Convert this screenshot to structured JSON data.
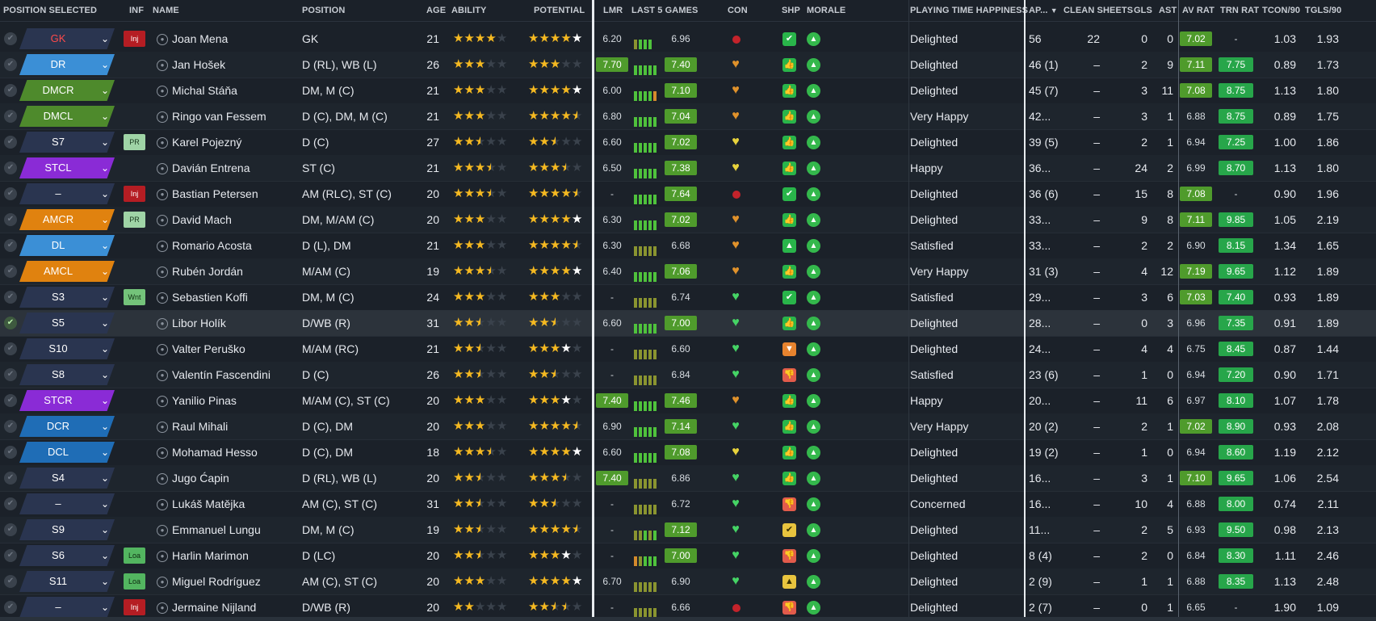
{
  "headers": {
    "position_selected": "POSITION SELECTED",
    "inf": "INF",
    "name": "NAME",
    "position": "POSITION",
    "age": "AGE",
    "ability": "ABILITY",
    "potential": "POTENTIAL",
    "lmr": "LMR",
    "last5": "LAST 5 GAMES",
    "con": "CON",
    "shp": "SHP",
    "morale": "MORALE",
    "pth": "PLAYING TIME HAPPINESS",
    "apps": "AP...",
    "sort_arrow": "▼",
    "clean_sheets": "CLEAN SHEETS",
    "gls": "GLS",
    "ast": "AST",
    "av_rat": "AV RAT",
    "trn_rat": "TRN RAT",
    "tcon90": "TCON/90",
    "tgls90": "TGLS/90"
  },
  "colors": {
    "blue": "#3b8fd6",
    "darkblue": "#1f6db6",
    "green": "#4e8a2c",
    "purple": "#8a2bd6",
    "orange": "#e0820f",
    "navy": "#2a3550",
    "red": "#b51d23"
  },
  "players": [
    {
      "pos": "GK",
      "posColor": "navy",
      "posText": "red",
      "inf": "Inj",
      "name": "Joan Mena",
      "position": "GK",
      "age": "21",
      "ability": [
        1,
        1,
        1,
        1,
        0
      ],
      "potential": [
        1,
        1,
        1,
        1,
        3
      ],
      "lmr": "6.20",
      "lmrHi": false,
      "bars": "yggg",
      "l5": "6.96",
      "l5Hi": false,
      "con": "red",
      "shp": "green",
      "shpIcon": "✔",
      "mor": "▲",
      "pth": "Delighted",
      "apps": "56",
      "cs": "22",
      "gls": "0",
      "ast": "0",
      "avr": "7.02",
      "avrHi": true,
      "trn": "-",
      "trnHi": false,
      "tcon": "1.03",
      "tgls": "1.93"
    },
    {
      "pos": "DR",
      "posColor": "blue",
      "inf": "",
      "name": "Jan Hošek",
      "position": "D (RL), WB (L)",
      "age": "26",
      "ability": [
        1,
        1,
        1,
        0,
        0
      ],
      "potential": [
        1,
        1,
        1,
        0,
        0
      ],
      "lmr": "7.70",
      "lmrHi": true,
      "bars": "ggggg",
      "l5": "7.40",
      "l5Hi": true,
      "con": "orange",
      "shp": "green",
      "shpIcon": "👍",
      "mor": "▲",
      "pth": "Delighted",
      "apps": "46 (1)",
      "cs": "–",
      "gls": "2",
      "ast": "9",
      "avr": "7.11",
      "avrHi": true,
      "trn": "7.75",
      "trnHi": true,
      "tcon": "0.89",
      "tgls": "1.73"
    },
    {
      "pos": "DMCR",
      "posColor": "green",
      "inf": "",
      "name": "Michal Stáňa",
      "position": "DM, M (C)",
      "age": "21",
      "ability": [
        1,
        1,
        1,
        0,
        0
      ],
      "potential": [
        1,
        1,
        1,
        1,
        3
      ],
      "lmr": "6.00",
      "lmrHi": false,
      "bars": "ggggo",
      "l5": "7.10",
      "l5Hi": true,
      "con": "orange",
      "shp": "green",
      "shpIcon": "👍",
      "mor": "▲",
      "pth": "Delighted",
      "apps": "45 (7)",
      "cs": "–",
      "gls": "3",
      "ast": "11",
      "avr": "7.08",
      "avrHi": true,
      "trn": "8.75",
      "trnHi": true,
      "tcon": "1.13",
      "tgls": "1.80"
    },
    {
      "pos": "DMCL",
      "posColor": "green",
      "inf": "",
      "name": "Ringo van Fessem",
      "position": "D (C), DM, M (C)",
      "age": "21",
      "ability": [
        1,
        1,
        1,
        0,
        0
      ],
      "potential": [
        1,
        1,
        1,
        1,
        2
      ],
      "lmr": "6.80",
      "lmrHi": false,
      "bars": "ggggg",
      "l5": "7.04",
      "l5Hi": true,
      "con": "orange",
      "shp": "green",
      "shpIcon": "👍",
      "mor": "▲",
      "pth": "Very Happy",
      "apps": "42...",
      "cs": "–",
      "gls": "3",
      "ast": "1",
      "avr": "6.88",
      "avrHi": false,
      "trn": "8.75",
      "trnHi": true,
      "tcon": "0.89",
      "tgls": "1.75"
    },
    {
      "pos": "S7",
      "posColor": "navy",
      "inf": "PR",
      "name": "Karel Pojezný",
      "position": "D (C)",
      "age": "27",
      "ability": [
        1,
        1,
        2,
        0,
        0
      ],
      "potential": [
        1,
        1,
        2,
        0,
        0
      ],
      "lmr": "6.60",
      "lmrHi": false,
      "bars": "ggggg",
      "l5": "7.02",
      "l5Hi": true,
      "con": "yellow",
      "shp": "green",
      "shpIcon": "👍",
      "mor": "▲",
      "pth": "Delighted",
      "apps": "39 (5)",
      "cs": "–",
      "gls": "2",
      "ast": "1",
      "avr": "6.94",
      "avrHi": false,
      "trn": "7.25",
      "trnHi": true,
      "tcon": "1.00",
      "tgls": "1.86"
    },
    {
      "pos": "STCL",
      "posColor": "purple",
      "inf": "",
      "name": "Davián Entrena",
      "position": "ST (C)",
      "age": "21",
      "ability": [
        1,
        1,
        1,
        2,
        0
      ],
      "potential": [
        1,
        1,
        1,
        2,
        0
      ],
      "lmr": "6.50",
      "lmrHi": false,
      "bars": "ggggg",
      "l5": "7.38",
      "l5Hi": true,
      "con": "yellow",
      "shp": "green",
      "shpIcon": "👍",
      "mor": "▲",
      "pth": "Happy",
      "apps": "36...",
      "cs": "–",
      "gls": "24",
      "ast": "2",
      "avr": "6.99",
      "avrHi": false,
      "trn": "8.70",
      "trnHi": true,
      "tcon": "1.13",
      "tgls": "1.80"
    },
    {
      "pos": "–",
      "posColor": "navy",
      "inf": "Inj",
      "name": "Bastian Petersen",
      "position": "AM (RLC), ST (C)",
      "age": "20",
      "ability": [
        1,
        1,
        1,
        2,
        0
      ],
      "potential": [
        1,
        1,
        1,
        1,
        2
      ],
      "lmr": "-",
      "lmrHi": false,
      "bars": "ggggg",
      "l5": "7.64",
      "l5Hi": true,
      "con": "red",
      "shp": "green",
      "shpIcon": "✔",
      "mor": "▲",
      "pth": "Delighted",
      "apps": "36 (6)",
      "cs": "–",
      "gls": "15",
      "ast": "8",
      "avr": "7.08",
      "avrHi": true,
      "trn": "-",
      "trnHi": false,
      "tcon": "0.90",
      "tgls": "1.96"
    },
    {
      "pos": "AMCR",
      "posColor": "orange",
      "inf": "PR",
      "name": "David Mach",
      "position": "DM, M/AM (C)",
      "age": "20",
      "ability": [
        1,
        1,
        1,
        0,
        0
      ],
      "potential": [
        1,
        1,
        1,
        1,
        3
      ],
      "lmr": "6.30",
      "lmrHi": false,
      "bars": "ggggg",
      "l5": "7.02",
      "l5Hi": true,
      "con": "orange",
      "shp": "green",
      "shpIcon": "👍",
      "mor": "▲",
      "pth": "Delighted",
      "apps": "33...",
      "cs": "–",
      "gls": "9",
      "ast": "8",
      "avr": "7.11",
      "avrHi": true,
      "trn": "9.85",
      "trnHi": true,
      "tcon": "1.05",
      "tgls": "2.19"
    },
    {
      "pos": "DL",
      "posColor": "blue",
      "inf": "",
      "name": "Romario Acosta",
      "position": "D (L), DM",
      "age": "21",
      "ability": [
        1,
        1,
        1,
        0,
        0
      ],
      "potential": [
        1,
        1,
        1,
        1,
        2
      ],
      "lmr": "6.30",
      "lmrHi": false,
      "bars": "yyyyy",
      "l5": "6.68",
      "l5Hi": false,
      "con": "orange",
      "shp": "green",
      "shpIcon": "▲",
      "mor": "▲",
      "pth": "Satisfied",
      "apps": "33...",
      "cs": "–",
      "gls": "2",
      "ast": "2",
      "avr": "6.90",
      "avrHi": false,
      "trn": "8.15",
      "trnHi": true,
      "tcon": "1.34",
      "tgls": "1.65"
    },
    {
      "pos": "AMCL",
      "posColor": "orange",
      "inf": "",
      "name": "Rubén Jordán",
      "position": "M/AM (C)",
      "age": "19",
      "ability": [
        1,
        1,
        1,
        2,
        0
      ],
      "potential": [
        1,
        1,
        1,
        1,
        3
      ],
      "lmr": "6.40",
      "lmrHi": false,
      "bars": "ggggg",
      "l5": "7.06",
      "l5Hi": true,
      "con": "orange",
      "shp": "green",
      "shpIcon": "👍",
      "mor": "▲",
      "pth": "Very Happy",
      "apps": "31 (3)",
      "cs": "–",
      "gls": "4",
      "ast": "12",
      "avr": "7.19",
      "avrHi": true,
      "trn": "9.65",
      "trnHi": true,
      "tcon": "1.12",
      "tgls": "1.89"
    },
    {
      "pos": "S3",
      "posColor": "navy",
      "inf": "Wnt",
      "name": "Sebastien Koffi",
      "position": "DM, M (C)",
      "age": "24",
      "ability": [
        1,
        1,
        1,
        0,
        0
      ],
      "potential": [
        1,
        1,
        1,
        0,
        0
      ],
      "lmr": "-",
      "lmrHi": false,
      "bars": "yyyyy",
      "l5": "6.74",
      "l5Hi": false,
      "con": "green",
      "shp": "green",
      "shpIcon": "✔",
      "mor": "▲",
      "pth": "Satisfied",
      "apps": "29...",
      "cs": "–",
      "gls": "3",
      "ast": "6",
      "avr": "7.03",
      "avrHi": true,
      "trn": "7.40",
      "trnHi": true,
      "tcon": "0.93",
      "tgls": "1.89"
    },
    {
      "pos": "S5",
      "posColor": "navy",
      "inf": "",
      "name": "Libor Holík",
      "position": "D/WB (R)",
      "age": "31",
      "ability": [
        1,
        1,
        2,
        0,
        0
      ],
      "potential": [
        1,
        1,
        2,
        0,
        0
      ],
      "lmr": "6.60",
      "lmrHi": false,
      "bars": "ggggg",
      "l5": "7.00",
      "l5Hi": true,
      "con": "green",
      "shp": "green",
      "shpIcon": "👍",
      "mor": "▲",
      "pth": "Delighted",
      "apps": "28...",
      "cs": "–",
      "gls": "0",
      "ast": "3",
      "avr": "6.96",
      "avrHi": false,
      "trn": "7.35",
      "trnHi": true,
      "tcon": "0.91",
      "tgls": "1.89",
      "selected": true
    },
    {
      "pos": "S10",
      "posColor": "navy",
      "inf": "",
      "name": "Valter Peruško",
      "position": "M/AM (RC)",
      "age": "21",
      "ability": [
        1,
        1,
        2,
        0,
        0
      ],
      "potential": [
        1,
        1,
        1,
        3,
        0
      ],
      "lmr": "-",
      "lmrHi": false,
      "bars": "yyyyy",
      "l5": "6.60",
      "l5Hi": false,
      "con": "green",
      "shp": "orange",
      "shpIcon": "▼",
      "mor": "▲",
      "pth": "Delighted",
      "apps": "24...",
      "cs": "–",
      "gls": "4",
      "ast": "4",
      "avr": "6.75",
      "avrHi": false,
      "trn": "8.45",
      "trnHi": true,
      "tcon": "0.87",
      "tgls": "1.44"
    },
    {
      "pos": "S8",
      "posColor": "navy",
      "inf": "",
      "name": "Valentín Fascendini",
      "position": "D (C)",
      "age": "26",
      "ability": [
        1,
        1,
        2,
        0,
        0
      ],
      "potential": [
        1,
        1,
        2,
        0,
        0
      ],
      "lmr": "-",
      "lmrHi": false,
      "bars": "yyyyy",
      "l5": "6.84",
      "l5Hi": false,
      "con": "green",
      "shp": "red",
      "shpIcon": "👎",
      "mor": "▲",
      "pth": "Satisfied",
      "apps": "23 (6)",
      "cs": "–",
      "gls": "1",
      "ast": "0",
      "avr": "6.94",
      "avrHi": false,
      "trn": "7.20",
      "trnHi": true,
      "tcon": "0.90",
      "tgls": "1.71"
    },
    {
      "pos": "STCR",
      "posColor": "purple",
      "inf": "",
      "name": "Yanilio Pinas",
      "position": "M/AM (C), ST (C)",
      "age": "20",
      "ability": [
        1,
        1,
        1,
        0,
        0
      ],
      "potential": [
        1,
        1,
        1,
        3,
        0
      ],
      "lmr": "7.40",
      "lmrHi": true,
      "bars": "ggggg",
      "l5": "7.46",
      "l5Hi": true,
      "con": "orange",
      "shp": "green",
      "shpIcon": "👍",
      "mor": "▲",
      "pth": "Happy",
      "apps": "20...",
      "cs": "–",
      "gls": "11",
      "ast": "6",
      "avr": "6.97",
      "avrHi": false,
      "trn": "8.10",
      "trnHi": true,
      "tcon": "1.07",
      "tgls": "1.78"
    },
    {
      "pos": "DCR",
      "posColor": "darkblue",
      "inf": "",
      "name": "Raul Mihali",
      "position": "D (C), DM",
      "age": "20",
      "ability": [
        1,
        1,
        1,
        0,
        0
      ],
      "potential": [
        1,
        1,
        1,
        1,
        2
      ],
      "lmr": "6.90",
      "lmrHi": false,
      "bars": "ggggg",
      "l5": "7.14",
      "l5Hi": true,
      "con": "green",
      "shp": "green",
      "shpIcon": "👍",
      "mor": "▲",
      "pth": "Very Happy",
      "apps": "20 (2)",
      "cs": "–",
      "gls": "2",
      "ast": "1",
      "avr": "7.02",
      "avrHi": true,
      "trn": "8.90",
      "trnHi": true,
      "tcon": "0.93",
      "tgls": "2.08"
    },
    {
      "pos": "DCL",
      "posColor": "darkblue",
      "inf": "",
      "name": "Mohamad Hesso",
      "position": "D (C), DM",
      "age": "18",
      "ability": [
        1,
        1,
        1,
        2,
        0
      ],
      "potential": [
        1,
        1,
        1,
        1,
        3
      ],
      "lmr": "6.60",
      "lmrHi": false,
      "bars": "ggggg",
      "l5": "7.08",
      "l5Hi": true,
      "con": "yellow",
      "shp": "green",
      "shpIcon": "👍",
      "mor": "▲",
      "pth": "Delighted",
      "apps": "19 (2)",
      "cs": "–",
      "gls": "1",
      "ast": "0",
      "avr": "6.94",
      "avrHi": false,
      "trn": "8.60",
      "trnHi": true,
      "tcon": "1.19",
      "tgls": "2.12"
    },
    {
      "pos": "S4",
      "posColor": "navy",
      "inf": "",
      "name": "Jugo Ćapin",
      "position": "D (RL), WB (L)",
      "age": "20",
      "ability": [
        1,
        1,
        2,
        0,
        0
      ],
      "potential": [
        1,
        1,
        1,
        2,
        0
      ],
      "lmr": "7.40",
      "lmrHi": true,
      "bars": "yyyyy",
      "l5": "6.86",
      "l5Hi": false,
      "con": "green",
      "shp": "green",
      "shpIcon": "👍",
      "mor": "▲",
      "pth": "Delighted",
      "apps": "16...",
      "cs": "–",
      "gls": "3",
      "ast": "1",
      "avr": "7.10",
      "avrHi": true,
      "trn": "9.65",
      "trnHi": true,
      "tcon": "1.06",
      "tgls": "2.54"
    },
    {
      "pos": "–",
      "posColor": "navy",
      "inf": "",
      "name": "Lukáš Matějka",
      "position": "AM (C), ST (C)",
      "age": "31",
      "ability": [
        1,
        1,
        2,
        0,
        0
      ],
      "potential": [
        1,
        1,
        2,
        0,
        0
      ],
      "lmr": "-",
      "lmrHi": false,
      "bars": "yyyyy",
      "l5": "6.72",
      "l5Hi": false,
      "con": "green",
      "shp": "red",
      "shpIcon": "👎",
      "mor": "▲",
      "pth": "Concerned",
      "apps": "16...",
      "cs": "–",
      "gls": "10",
      "ast": "4",
      "avr": "6.88",
      "avrHi": false,
      "trn": "8.00",
      "trnHi": true,
      "tcon": "0.74",
      "tgls": "2.11"
    },
    {
      "pos": "S9",
      "posColor": "navy",
      "inf": "",
      "name": "Emmanuel Lungu",
      "position": "DM, M (C)",
      "age": "19",
      "ability": [
        1,
        1,
        2,
        0,
        0
      ],
      "potential": [
        1,
        1,
        1,
        1,
        2
      ],
      "lmr": "-",
      "lmrHi": false,
      "bars": "yygyg",
      "l5": "7.12",
      "l5Hi": true,
      "con": "green",
      "shp": "yellow",
      "shpIcon": "✔",
      "mor": "▲",
      "pth": "Delighted",
      "apps": "11...",
      "cs": "–",
      "gls": "2",
      "ast": "5",
      "avr": "6.93",
      "avrHi": false,
      "trn": "9.50",
      "trnHi": true,
      "tcon": "0.98",
      "tgls": "2.13"
    },
    {
      "pos": "S6",
      "posColor": "navy",
      "inf": "Loa",
      "name": "Harlin Marimon",
      "position": "D (LC)",
      "age": "20",
      "ability": [
        1,
        1,
        2,
        0,
        0
      ],
      "potential": [
        1,
        1,
        1,
        3,
        0
      ],
      "lmr": "-",
      "lmrHi": false,
      "bars": "oyggg",
      "l5": "7.00",
      "l5Hi": true,
      "con": "green",
      "shp": "red",
      "shpIcon": "👎",
      "mor": "▲",
      "pth": "Delighted",
      "apps": "8 (4)",
      "cs": "–",
      "gls": "2",
      "ast": "0",
      "avr": "6.84",
      "avrHi": false,
      "trn": "8.30",
      "trnHi": true,
      "tcon": "1.11",
      "tgls": "2.46"
    },
    {
      "pos": "S11",
      "posColor": "navy",
      "inf": "Loa",
      "name": "Miguel Rodríguez",
      "position": "AM (C), ST (C)",
      "age": "20",
      "ability": [
        1,
        1,
        1,
        0,
        0
      ],
      "potential": [
        1,
        1,
        1,
        1,
        3
      ],
      "lmr": "6.70",
      "lmrHi": false,
      "bars": "yyyyy",
      "l5": "6.90",
      "l5Hi": false,
      "con": "green",
      "shp": "yellow",
      "shpIcon": "▲",
      "mor": "▲",
      "pth": "Delighted",
      "apps": "2 (9)",
      "cs": "–",
      "gls": "1",
      "ast": "1",
      "avr": "6.88",
      "avrHi": false,
      "trn": "8.35",
      "trnHi": true,
      "tcon": "1.13",
      "tgls": "2.48"
    },
    {
      "pos": "–",
      "posColor": "navy",
      "inf": "Inj",
      "name": "Jermaine Nijland",
      "position": "D/WB (R)",
      "age": "20",
      "ability": [
        1,
        1,
        0,
        0,
        0
      ],
      "potential": [
        1,
        1,
        2,
        2,
        0
      ],
      "lmr": "-",
      "lmrHi": false,
      "bars": "yyyyy",
      "l5": "6.66",
      "l5Hi": false,
      "con": "red",
      "shp": "red",
      "shpIcon": "👎",
      "mor": "▲",
      "pth": "Delighted",
      "apps": "2 (7)",
      "cs": "–",
      "gls": "0",
      "ast": "1",
      "avr": "6.65",
      "avrHi": false,
      "trn": "-",
      "trnHi": false,
      "tcon": "1.90",
      "tgls": "1.09"
    }
  ]
}
